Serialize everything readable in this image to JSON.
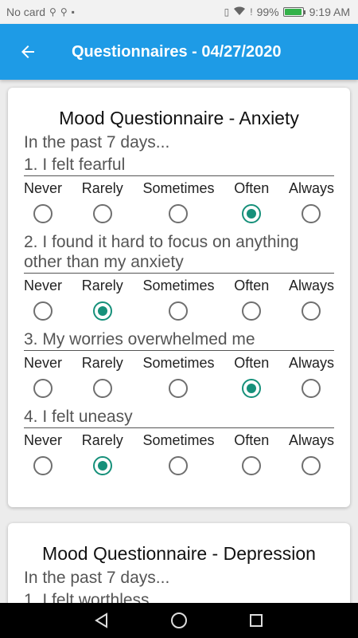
{
  "status_bar": {
    "carrier": "No card",
    "battery_percent": "99%",
    "battery_level": 0.99,
    "time": "9:19 AM"
  },
  "app_bar": {
    "title": "Questionnaires - 04/27/2020"
  },
  "cards": [
    {
      "title": "Mood Questionnaire - Anxiety",
      "intro": "In the past 7 days...",
      "options": [
        "Never",
        "Rarely",
        "Sometimes",
        "Often",
        "Always"
      ],
      "questions": [
        {
          "text": "1. I felt fearful",
          "selected": "Often"
        },
        {
          "text": "2. I found it hard to focus on anything other than my anxiety",
          "selected": "Rarely"
        },
        {
          "text": "3. My worries overwhelmed me",
          "selected": "Often"
        },
        {
          "text": "4. I felt uneasy",
          "selected": "Rarely"
        }
      ]
    },
    {
      "title": "Mood Questionnaire - Depression",
      "intro": "In the past 7 days...",
      "questions": [
        {
          "text": "1. I felt worthless"
        }
      ]
    }
  ],
  "colors": {
    "app_bar": "#1e9be6",
    "radio_selected": "#16907a",
    "battery": "#34b24a"
  }
}
